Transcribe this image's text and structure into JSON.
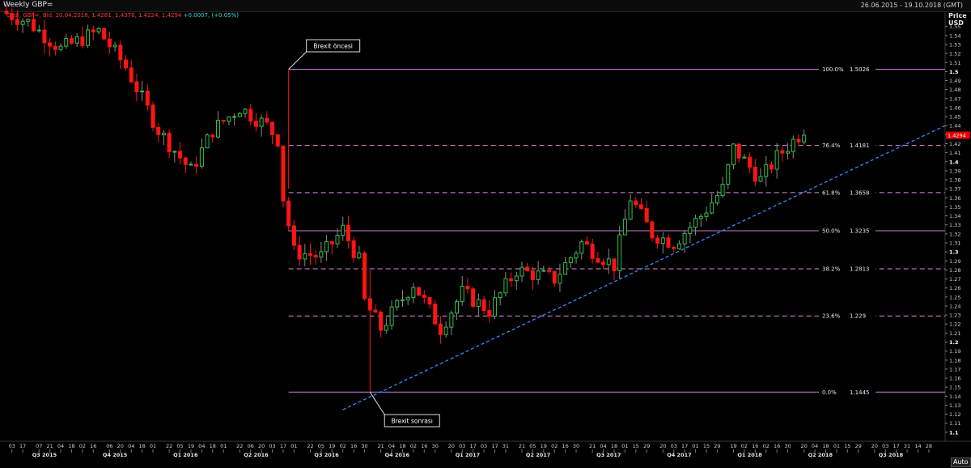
{
  "window": {
    "title": "Weekly GBP=",
    "date_range": "26.06.2015 - 19.10.2018 (GMT)",
    "ohlc_readout": "Cndl, GBP=, Bid, 20.04.2018, 1.4281, 1.4376, 1.4224, 1.4294",
    "change_readout": "+0.0007, (+0.05%)",
    "axis_unit_lines": [
      "Price",
      "USD"
    ],
    "current_price_label": "1.4294",
    "auto_button": "Auto"
  },
  "colors": {
    "background": "#000000",
    "up_candle": "#2fc24a",
    "down_candle": "#ff1414",
    "fib_solid": "#c77ad9",
    "fib_dashed": "#e08be0",
    "trendline": "#2f8fff",
    "grid": "#3a3a3a",
    "axis_text": "#cfcfcf"
  },
  "annotations": [
    {
      "id": "pre",
      "text": "Brexit öncesi",
      "anchor_date": "2016-06-24",
      "anchor_price": 1.5026
    },
    {
      "id": "post",
      "text": "Brexit sonrası",
      "anchor_date": "2016-10-07",
      "anchor_price": 1.1445
    }
  ],
  "chart_data": {
    "type": "candlestick",
    "instrument": "GBP=",
    "timeframe": "Weekly",
    "x_range": [
      "2015-06-26",
      "2018-10-19"
    ],
    "y_range": [
      1.09,
      1.565
    ],
    "y_ticks": [
      1.1,
      1.11,
      1.12,
      1.13,
      1.14,
      1.15,
      1.16,
      1.17,
      1.18,
      1.19,
      1.2,
      1.21,
      1.22,
      1.23,
      1.24,
      1.25,
      1.26,
      1.27,
      1.28,
      1.29,
      1.3,
      1.31,
      1.32,
      1.33,
      1.34,
      1.35,
      1.36,
      1.37,
      1.38,
      1.39,
      1.4,
      1.41,
      1.42,
      1.43,
      1.44,
      1.45,
      1.46,
      1.47,
      1.48,
      1.49,
      1.5,
      1.51,
      1.52,
      1.53,
      1.54,
      1.55
    ],
    "bold_y_ticks": [
      1.1,
      1.2,
      1.3,
      1.4,
      1.5
    ],
    "x_day_ticks": [
      {
        "date": "2015-07-03",
        "label": "03"
      },
      {
        "date": "2015-07-17",
        "label": "17"
      },
      {
        "date": "2015-08-07",
        "label": "07"
      },
      {
        "date": "2015-08-21",
        "label": "21"
      },
      {
        "date": "2015-09-04",
        "label": "04"
      },
      {
        "date": "2015-09-18",
        "label": "18"
      },
      {
        "date": "2015-10-02",
        "label": "02"
      },
      {
        "date": "2015-10-16",
        "label": "16"
      },
      {
        "date": "2015-11-06",
        "label": "06"
      },
      {
        "date": "2015-11-20",
        "label": "20"
      },
      {
        "date": "2015-12-04",
        "label": "04"
      },
      {
        "date": "2015-12-18",
        "label": "18"
      },
      {
        "date": "2016-01-01",
        "label": "01"
      },
      {
        "date": "2016-01-22",
        "label": "22"
      },
      {
        "date": "2016-02-05",
        "label": "05"
      },
      {
        "date": "2016-02-19",
        "label": "19"
      },
      {
        "date": "2016-03-04",
        "label": "04"
      },
      {
        "date": "2016-03-18",
        "label": "18"
      },
      {
        "date": "2016-04-01",
        "label": "01"
      },
      {
        "date": "2016-04-22",
        "label": "22"
      },
      {
        "date": "2016-05-06",
        "label": "06"
      },
      {
        "date": "2016-05-20",
        "label": "20"
      },
      {
        "date": "2016-06-03",
        "label": "03"
      },
      {
        "date": "2016-06-17",
        "label": "17"
      },
      {
        "date": "2016-07-01",
        "label": "01"
      },
      {
        "date": "2016-07-22",
        "label": "22"
      },
      {
        "date": "2016-08-05",
        "label": "05"
      },
      {
        "date": "2016-08-19",
        "label": "19"
      },
      {
        "date": "2016-09-02",
        "label": "02"
      },
      {
        "date": "2016-09-16",
        "label": "16"
      },
      {
        "date": "2016-09-30",
        "label": "30"
      },
      {
        "date": "2016-10-21",
        "label": "21"
      },
      {
        "date": "2016-11-04",
        "label": "04"
      },
      {
        "date": "2016-11-18",
        "label": "18"
      },
      {
        "date": "2016-12-02",
        "label": "02"
      },
      {
        "date": "2016-12-16",
        "label": "16"
      },
      {
        "date": "2016-12-30",
        "label": "30"
      },
      {
        "date": "2017-01-20",
        "label": "20"
      },
      {
        "date": "2017-02-03",
        "label": "03"
      },
      {
        "date": "2017-02-17",
        "label": "17"
      },
      {
        "date": "2017-03-03",
        "label": "03"
      },
      {
        "date": "2017-03-17",
        "label": "17"
      },
      {
        "date": "2017-03-31",
        "label": "31"
      },
      {
        "date": "2017-04-21",
        "label": "21"
      },
      {
        "date": "2017-05-05",
        "label": "05"
      },
      {
        "date": "2017-05-19",
        "label": "19"
      },
      {
        "date": "2017-06-02",
        "label": "02"
      },
      {
        "date": "2017-06-16",
        "label": "16"
      },
      {
        "date": "2017-06-30",
        "label": "30"
      },
      {
        "date": "2017-07-21",
        "label": "21"
      },
      {
        "date": "2017-08-04",
        "label": "04"
      },
      {
        "date": "2017-08-18",
        "label": "18"
      },
      {
        "date": "2017-09-01",
        "label": "01"
      },
      {
        "date": "2017-09-15",
        "label": "15"
      },
      {
        "date": "2017-09-29",
        "label": "29"
      },
      {
        "date": "2017-10-20",
        "label": "20"
      },
      {
        "date": "2017-11-03",
        "label": "03"
      },
      {
        "date": "2017-11-17",
        "label": "17"
      },
      {
        "date": "2017-12-01",
        "label": "01"
      },
      {
        "date": "2017-12-15",
        "label": "15"
      },
      {
        "date": "2017-12-29",
        "label": "29"
      },
      {
        "date": "2018-01-19",
        "label": "19"
      },
      {
        "date": "2018-02-02",
        "label": "02"
      },
      {
        "date": "2018-02-16",
        "label": "16"
      },
      {
        "date": "2018-03-02",
        "label": "02"
      },
      {
        "date": "2018-03-16",
        "label": "16"
      },
      {
        "date": "2018-03-30",
        "label": "30"
      },
      {
        "date": "2018-04-20",
        "label": "20"
      },
      {
        "date": "2018-05-04",
        "label": "04"
      },
      {
        "date": "2018-05-18",
        "label": "18"
      },
      {
        "date": "2018-06-01",
        "label": "01"
      },
      {
        "date": "2018-06-15",
        "label": "15"
      },
      {
        "date": "2018-06-29",
        "label": "29"
      },
      {
        "date": "2018-07-20",
        "label": "20"
      },
      {
        "date": "2018-08-03",
        "label": "03"
      },
      {
        "date": "2018-08-17",
        "label": "17"
      },
      {
        "date": "2018-08-31",
        "label": "31"
      },
      {
        "date": "2018-09-14",
        "label": "14"
      },
      {
        "date": "2018-09-28",
        "label": "28"
      },
      {
        "date": "2018-10-19",
        "label": "19"
      }
    ],
    "quarter_labels": [
      {
        "label": "Q3 2015",
        "date": "2015-08-14"
      },
      {
        "label": "Q4 2015",
        "date": "2015-11-13"
      },
      {
        "label": "Q1 2016",
        "date": "2016-02-12"
      },
      {
        "label": "Q2 2016",
        "date": "2016-05-13"
      },
      {
        "label": "Q3 2016",
        "date": "2016-08-12"
      },
      {
        "label": "Q4 2016",
        "date": "2016-11-11"
      },
      {
        "label": "Q1 2017",
        "date": "2017-02-10"
      },
      {
        "label": "Q2 2017",
        "date": "2017-05-12"
      },
      {
        "label": "Q3 2017",
        "date": "2017-08-11"
      },
      {
        "label": "Q4 2017",
        "date": "2017-11-10"
      },
      {
        "label": "Q1 2018",
        "date": "2018-02-09"
      },
      {
        "label": "Q2 2018",
        "date": "2018-05-11"
      },
      {
        "label": "Q3 2018",
        "date": "2018-08-10"
      }
    ],
    "fibonacci": [
      {
        "label": "100.0%",
        "value": 1.5026,
        "value_label": "1.5026",
        "style": "solid"
      },
      {
        "label": "76.4%",
        "value": 1.4181,
        "value_label": "1.4181",
        "style": "dashed"
      },
      {
        "label": "61.8%",
        "value": 1.3658,
        "value_label": "1.3658",
        "style": "dashed"
      },
      {
        "label": "50.0%",
        "value": 1.3235,
        "value_label": "1.3235",
        "style": "solid"
      },
      {
        "label": "38.2%",
        "value": 1.2813,
        "value_label": "1.2813",
        "style": "dashed"
      },
      {
        "label": "23.6%",
        "value": 1.229,
        "value_label": "1.229",
        "style": "dashed"
      },
      {
        "label": "0.0%",
        "value": 1.1445,
        "value_label": "1.1445",
        "style": "solid"
      }
    ],
    "trendline": {
      "start": {
        "date": "2016-09-02",
        "value": 1.125
      },
      "end": {
        "date": "2018-10-19",
        "value": 1.44
      }
    },
    "anchors": [
      {
        "date": "2015-06-26",
        "price": 1.567
      },
      {
        "date": "2015-07-31",
        "price": 1.555
      },
      {
        "date": "2015-09-11",
        "price": 1.525
      },
      {
        "date": "2015-10-30",
        "price": 1.545
      },
      {
        "date": "2015-12-04",
        "price": 1.505
      },
      {
        "date": "2016-01-15",
        "price": 1.435
      },
      {
        "date": "2016-02-26",
        "price": 1.39
      },
      {
        "date": "2016-03-25",
        "price": 1.435
      },
      {
        "date": "2016-04-29",
        "price": 1.46
      },
      {
        "date": "2016-06-03",
        "price": 1.44
      },
      {
        "date": "2016-06-17",
        "price": 1.425
      },
      {
        "date": "2016-06-24",
        "price": 1.36
      },
      {
        "date": "2016-07-08",
        "price": 1.3
      },
      {
        "date": "2016-08-12",
        "price": 1.295
      },
      {
        "date": "2016-09-09",
        "price": 1.325
      },
      {
        "date": "2016-09-30",
        "price": 1.29
      },
      {
        "date": "2016-10-07",
        "price": 1.245
      },
      {
        "date": "2016-10-28",
        "price": 1.215
      },
      {
        "date": "2016-12-09",
        "price": 1.265
      },
      {
        "date": "2017-01-13",
        "price": 1.215
      },
      {
        "date": "2017-02-10",
        "price": 1.255
      },
      {
        "date": "2017-03-17",
        "price": 1.235
      },
      {
        "date": "2017-04-21",
        "price": 1.28
      },
      {
        "date": "2017-06-09",
        "price": 1.27
      },
      {
        "date": "2017-07-14",
        "price": 1.31
      },
      {
        "date": "2017-08-25",
        "price": 1.285
      },
      {
        "date": "2017-09-15",
        "price": 1.36
      },
      {
        "date": "2017-10-13",
        "price": 1.32
      },
      {
        "date": "2017-11-10",
        "price": 1.31
      },
      {
        "date": "2017-12-15",
        "price": 1.34
      },
      {
        "date": "2018-01-12",
        "price": 1.37
      },
      {
        "date": "2018-01-26",
        "price": 1.415
      },
      {
        "date": "2018-03-02",
        "price": 1.38
      },
      {
        "date": "2018-03-23",
        "price": 1.405
      },
      {
        "date": "2018-04-20",
        "price": 1.4294
      }
    ]
  }
}
